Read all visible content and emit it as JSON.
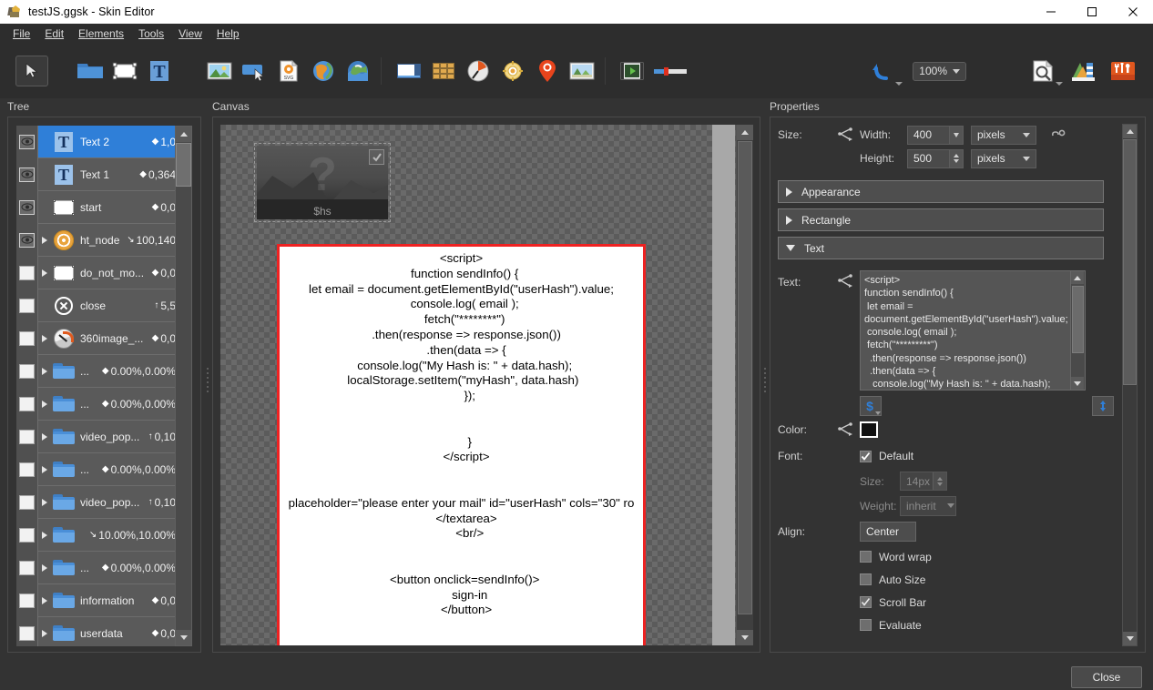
{
  "titlebar": {
    "title": "testJS.ggsk - Skin Editor",
    "app_icon": "skin-editor-icon",
    "minimize": "minimize-icon",
    "maximize": "maximize-icon",
    "close": "close-icon"
  },
  "menubar": {
    "items": [
      {
        "label": "File",
        "accel": "F"
      },
      {
        "label": "Edit",
        "accel": "E"
      },
      {
        "label": "Elements",
        "accel": "l"
      },
      {
        "label": "Tools",
        "accel": "T"
      },
      {
        "label": "View",
        "accel": "V"
      },
      {
        "label": "Help",
        "accel": "H"
      }
    ]
  },
  "toolbar": {
    "items": [
      {
        "name": "select-arrow-tool",
        "selected": true
      },
      {
        "name": "container-tool",
        "selected": false
      },
      {
        "name": "rectangle-tool",
        "selected": false
      },
      {
        "name": "text-tool",
        "selected": false
      },
      {
        "name": "image-tool",
        "selected": false
      },
      {
        "name": "button-tool",
        "selected": false
      },
      {
        "name": "svg-tool",
        "selected": false
      },
      {
        "name": "globe-tool",
        "selected": false
      },
      {
        "name": "map-tool",
        "selected": false
      },
      {
        "name": "window-tool",
        "selected": false
      },
      {
        "name": "thumbnail-grid-tool",
        "selected": false
      },
      {
        "name": "compass-tool",
        "selected": false
      },
      {
        "name": "radar-tool",
        "selected": false
      },
      {
        "name": "hotspot-pin-tool",
        "selected": false
      },
      {
        "name": "map-image-tool",
        "selected": false
      },
      {
        "name": "video-tool",
        "selected": false
      },
      {
        "name": "slider-tool",
        "selected": false
      }
    ],
    "undo": "undo-icon",
    "zoom_value": "100%",
    "preview": "preview-icon",
    "styles": "styles-icon",
    "plugins": "plugins-icon"
  },
  "tree": {
    "label": "Tree",
    "rows": [
      {
        "visible": true,
        "expander": false,
        "icon": "text-icon",
        "label": "Text 2",
        "coord": "1,0",
        "marker": "dot",
        "selected": true
      },
      {
        "visible": true,
        "expander": false,
        "icon": "text-icon",
        "label": "Text 1",
        "coord": "0,364",
        "marker": "dot",
        "selected": false
      },
      {
        "visible": true,
        "expander": false,
        "icon": "rectangle-icon",
        "label": "start",
        "coord": "0,0",
        "marker": "dot",
        "selected": false
      },
      {
        "visible": true,
        "expander": true,
        "icon": "hotspot-icon",
        "label": "ht_node",
        "coord": "100,140",
        "marker": "down",
        "selected": false
      },
      {
        "visible": false,
        "expander": true,
        "icon": "rectangle-icon",
        "label": "do_not_mo...",
        "coord": "0,0",
        "marker": "dot",
        "selected": false
      },
      {
        "visible": false,
        "expander": false,
        "icon": "close-circle-icon",
        "label": "close",
        "coord": "5,5",
        "marker": "up",
        "selected": false
      },
      {
        "visible": false,
        "expander": true,
        "icon": "compass-icon",
        "label": "360image_...",
        "coord": "0,0",
        "marker": "dot",
        "selected": false
      },
      {
        "visible": false,
        "expander": true,
        "icon": "folder-icon",
        "label": "...",
        "coord": "0.00%,0.00%",
        "marker": "dot",
        "selected": false
      },
      {
        "visible": false,
        "expander": true,
        "icon": "folder-icon",
        "label": "...",
        "coord": "0.00%,0.00%",
        "marker": "dot",
        "selected": false
      },
      {
        "visible": false,
        "expander": true,
        "icon": "folder-icon",
        "label": "video_pop...",
        "coord": "0,10",
        "marker": "up",
        "selected": false
      },
      {
        "visible": false,
        "expander": true,
        "icon": "folder-icon",
        "label": "...",
        "coord": "0.00%,0.00%",
        "marker": "dot",
        "selected": false
      },
      {
        "visible": false,
        "expander": true,
        "icon": "folder-icon",
        "label": "video_pop...",
        "coord": "0,10",
        "marker": "up",
        "selected": false
      },
      {
        "visible": false,
        "expander": true,
        "icon": "folder-icon",
        "label": "",
        "coord": "10.00%,10.00%",
        "marker": "down",
        "selected": false
      },
      {
        "visible": false,
        "expander": true,
        "icon": "folder-icon",
        "label": "...",
        "coord": "0.00%,0.00%",
        "marker": "dot",
        "selected": false
      },
      {
        "visible": false,
        "expander": true,
        "icon": "folder-icon",
        "label": "information",
        "coord": "0,0",
        "marker": "dot",
        "selected": false
      },
      {
        "visible": false,
        "expander": true,
        "icon": "folder-icon",
        "label": "userdata",
        "coord": "0,0",
        "marker": "dot",
        "selected": false
      }
    ]
  },
  "canvas": {
    "label": "Canvas",
    "thumbnail": {
      "caption": "$hs",
      "checkbox": "checkbox-checked-icon"
    },
    "text_element": {
      "border_color": "#ee2222",
      "content": "<script>\n  function sendInfo() {\nlet email = document.getElementById(\"userHash\").value;\n  console.log( email );\n  fetch(\"********\")\n   .then(response => response.json())\n   .then(data => {\n  console.log(\"My Hash is: \" + data.hash);\n localStorage.setItem(\"myHash\", data.hash)\n     });\n\n\n     }\n   </script>\n\n\nplaceholder=\"please enter your mail\" id=\"userHash\" cols=\"30\" ro\n   </textarea>\n     <br/>\n\n\n  <button onclick=sendInfo()>\n     sign-in\n   </button>"
    }
  },
  "properties": {
    "label": "Properties",
    "size": {
      "label": "Size:",
      "width_label": "Width:",
      "width_value": "400",
      "width_unit": "pixels",
      "height_label": "Height:",
      "height_value": "500",
      "height_unit": "pixels",
      "link_icon": "link-icon",
      "share_icon": "share-icon"
    },
    "sections": [
      {
        "label": "Appearance",
        "expanded": false
      },
      {
        "label": "Rectangle",
        "expanded": false
      },
      {
        "label": "Text",
        "expanded": true
      }
    ],
    "text_section": {
      "text_label": "Text:",
      "text_value": "<script>\nfunction sendInfo() {\n let email =\ndocument.getElementById(\"userHash\").value;\n console.log( email );\n fetch(\"*********\")\n  .then(response => response.json())\n  .then(data => {\n   console.log(\"My Hash is: \" + data.hash);\n   localStorage.setItem(\"myHash\", data.hash)",
      "variable_button": "variable-dollar-icon",
      "expand_button": "expand-editor-icon",
      "color_label": "Color:",
      "color_value": "#000000",
      "font_label": "Font:",
      "font_default_label": "Default",
      "font_default_checked": true,
      "size_label": "Size:",
      "size_value": "14px",
      "weight_label": "Weight:",
      "weight_value": "inherit",
      "align_label": "Align:",
      "align_value": "Center",
      "checkboxes": [
        {
          "label": "Word wrap",
          "checked": false
        },
        {
          "label": "Auto Size",
          "checked": false
        },
        {
          "label": "Scroll Bar",
          "checked": true
        },
        {
          "label": "Evaluate",
          "checked": false
        }
      ]
    }
  },
  "footer": {
    "close_label": "Close"
  }
}
